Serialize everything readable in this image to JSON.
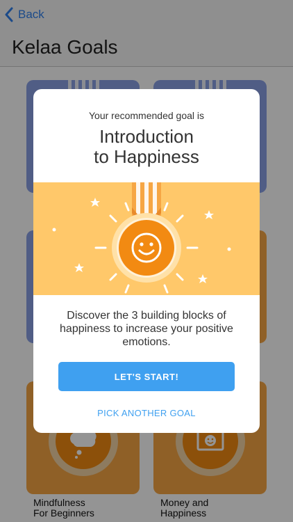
{
  "nav": {
    "back_label": "Back",
    "title": "Kelaa Goals",
    "back_icon": "chevron-left-icon"
  },
  "goals_grid": {
    "cards": [
      {
        "label": "Mindfulness\nFor Beginners",
        "icon": "thought-cloud-icon",
        "color": "#f6a644"
      },
      {
        "label": "Money and\nHappiness",
        "icon": "money-bill-icon",
        "color": "#f6a644"
      }
    ],
    "blue_color": "#8aa0e6"
  },
  "modal": {
    "kicker": "Your recommended goal is",
    "goal_name": "Introduction\nto Happiness",
    "hero_icon": "smiley-medal-icon",
    "description": "Discover the 3 building blocks of happiness to increase your positive emotions.",
    "primary_button": "LET'S START!",
    "secondary_link": "PICK ANOTHER GOAL"
  },
  "colors": {
    "accent": "#3fa0f0",
    "hero_background": "#ffc86a",
    "medal_orange": "#f28a12",
    "overlay": "rgba(0,0,0,0.42)"
  }
}
